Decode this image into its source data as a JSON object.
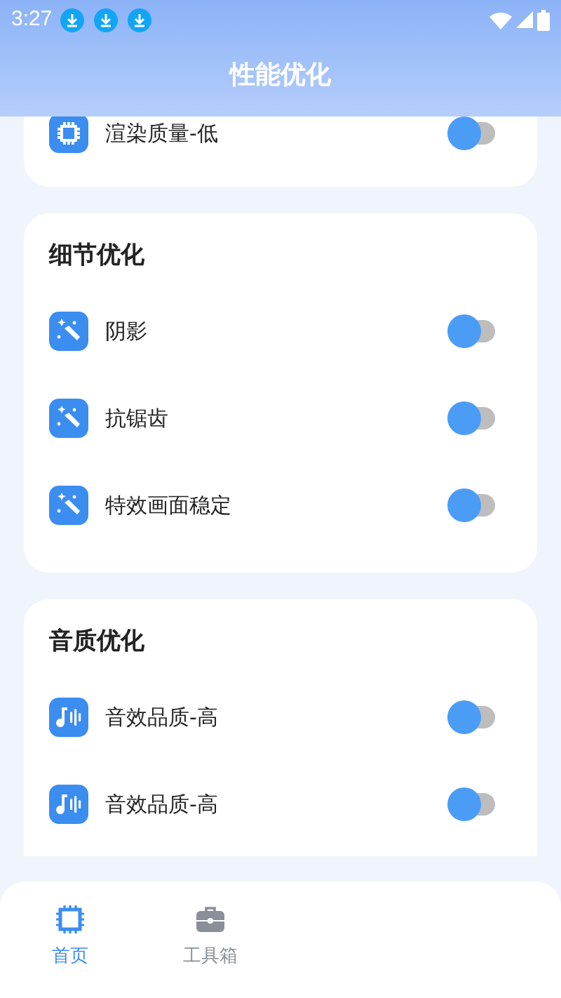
{
  "status_bar": {
    "time": "3:27",
    "notifications": [
      {
        "kind": "download"
      },
      {
        "kind": "download"
      },
      {
        "kind": "download"
      }
    ]
  },
  "header": {
    "title": "性能优化"
  },
  "sections": [
    {
      "items": [
        {
          "kind": "chip",
          "label": "渲染质量-低",
          "on": false
        }
      ]
    },
    {
      "title": "细节优化",
      "items": [
        {
          "kind": "wand",
          "label": "阴影",
          "on": false
        },
        {
          "kind": "wand",
          "label": "抗锯齿",
          "on": false
        },
        {
          "kind": "wand",
          "label": "特效画面稳定",
          "on": false
        }
      ]
    },
    {
      "title": "音质优化",
      "items": [
        {
          "kind": "music",
          "label": "音效品质-高",
          "on": false
        },
        {
          "kind": "music",
          "label": "音效品质-高",
          "on": false
        }
      ]
    }
  ],
  "nav": [
    {
      "kind": "chip",
      "label": "首页",
      "selected": true
    },
    {
      "kind": "toolbox",
      "label": "工具箱",
      "selected": false
    }
  ]
}
